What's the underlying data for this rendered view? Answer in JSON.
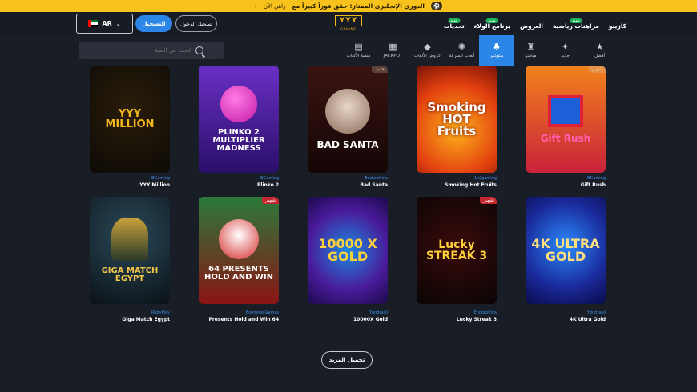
{
  "promo": {
    "icon": "tournament-icon",
    "text": "الدوري الإنجليزي الممتاز: حقق فوزاً كبيراً مع",
    "link": "راهن الآن",
    "arrow": "‹"
  },
  "header": {
    "language": "AR",
    "register": "التسجيل",
    "login": "تسجيل الدخول",
    "logo": "YYY",
    "logo_sub": "GAMING",
    "nav": [
      {
        "label": "كازينو",
        "badge": ""
      },
      {
        "label": "مراهنات رياضية",
        "badge": "جديد"
      },
      {
        "label": "العروض",
        "badge": ""
      },
      {
        "label": "برنامج الولاء",
        "badge": "جديد"
      },
      {
        "label": "تحديات",
        "badge": "جديد"
      }
    ]
  },
  "search": {
    "placeholder": "ابحث عن اللعبة"
  },
  "categories": [
    {
      "label": "أفضل",
      "icon": "star-icon",
      "glyph": "★"
    },
    {
      "label": "جديد",
      "icon": "new-icon",
      "glyph": "✦"
    },
    {
      "label": "مباشر",
      "icon": "live-icon",
      "glyph": "♜"
    },
    {
      "label": "سلوتس",
      "icon": "slots-cherry-icon",
      "glyph": "♣",
      "active": true
    },
    {
      "label": "ألعاب السرعة",
      "icon": "crash-icon",
      "glyph": "✺"
    },
    {
      "label": "عروض الألعاب",
      "icon": "diamond-icon",
      "glyph": "◆"
    },
    {
      "label": "JACKPOT",
      "icon": "jackpot-icon",
      "glyph": "▦"
    },
    {
      "label": "منصة الألعاب",
      "icon": "platform-icon",
      "glyph": "▤"
    }
  ],
  "games": [
    {
      "title_art": "YYY MILLION",
      "provider": "BGaming",
      "name": "YYY Million",
      "tag": ""
    },
    {
      "title_art": "PLINKO 2 MULTIPLIER MADNESS",
      "provider": "BGaming",
      "name": "Plinko 2",
      "tag": ""
    },
    {
      "title_art": "BAD SANTA",
      "provider": "Endorphina",
      "name": "Bad Santa",
      "tag": "جديد"
    },
    {
      "title_art": "Smoking HOT Fruits",
      "provider": "1x2gaming",
      "name": "Smoking Hot Fruits",
      "tag": ""
    },
    {
      "title_art": "Gift Rush",
      "provider": "BGaming",
      "name": "Gift Rush",
      "tag": "شهير"
    },
    {
      "title_art": "GIGA MATCH EGYPT",
      "provider": "RubyPlay",
      "name": "Giga Match Egypt",
      "tag": ""
    },
    {
      "title_art": "64 PRESENTS HOLD AND WIN",
      "provider": "Booming Games",
      "name": "Presents Hold and Win 64",
      "tag": "شهير"
    },
    {
      "title_art": "10000 X GOLD",
      "provider": "Yggdrasil",
      "name": "10000X Gold",
      "tag": ""
    },
    {
      "title_art": "Lucky STREAK 3",
      "provider": "Endorphina",
      "name": "Lucky Streak 3",
      "tag": "شهير"
    },
    {
      "title_art": "4K ULTRA GOLD",
      "provider": "Yggdrasil",
      "name": "4K Ultra Gold",
      "tag": ""
    }
  ],
  "load_more": "تحميل المزيد",
  "colors": {
    "accent": "#2c86e8",
    "promo_bar": "#f7c21c",
    "background": "#191d26",
    "provider_text": "#3a8fe8",
    "tag_red": "#c5252c"
  }
}
